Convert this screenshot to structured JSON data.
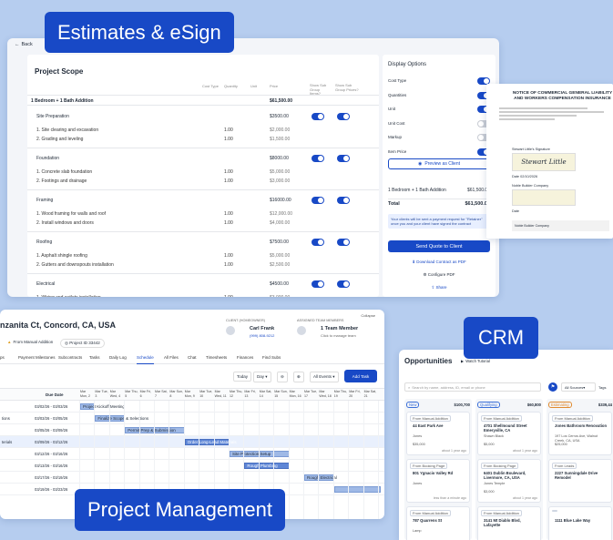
{
  "labels": {
    "estimates": "Estimates & eSign",
    "crm": "CRM",
    "pm": "Project Management"
  },
  "estimate": {
    "back": "Back",
    "title": "Project Scope",
    "headers": [
      "Cost Type",
      "Quantity",
      "Unit",
      "Price",
      "Show Sub Group Items?",
      "Show Sub Group Prices?"
    ],
    "top_group": {
      "name": "1 Bedroom + 1 Bath Addition",
      "price": "$61,500.00"
    },
    "groups": [
      {
        "name": "Site Preparation",
        "price": "$3500.00",
        "items": [
          {
            "name": "1. Site clearing and excavation",
            "qty": "1.00",
            "price": "$2,000.00"
          },
          {
            "name": "2. Grading and leveling",
            "qty": "1.00",
            "price": "$1,500.00"
          }
        ]
      },
      {
        "name": "Foundation",
        "price": "$8000.00",
        "items": [
          {
            "name": "1. Concrete slab foundation",
            "qty": "1.00",
            "price": "$5,000.00"
          },
          {
            "name": "2. Footings and drainage",
            "qty": "1.00",
            "price": "$3,000.00"
          }
        ]
      },
      {
        "name": "Framing",
        "price": "$16000.00",
        "items": [
          {
            "name": "1. Wood framing for walls and roof",
            "qty": "1.00",
            "price": "$12,000.00"
          },
          {
            "name": "2. Install windows and doors",
            "qty": "1.00",
            "price": "$4,000.00"
          }
        ]
      },
      {
        "name": "Roofing",
        "price": "$7500.00",
        "items": [
          {
            "name": "1. Asphalt shingle roofing",
            "qty": "1.00",
            "price": "$5,000.00"
          },
          {
            "name": "2. Gutters and downspouts installation",
            "qty": "1.00",
            "price": "$2,500.00"
          }
        ]
      },
      {
        "name": "Electrical",
        "price": "$4500.00",
        "items": [
          {
            "name": "1. Wiring and outlets installation",
            "qty": "1.00",
            "price": "$3,000.00"
          }
        ]
      }
    ]
  },
  "display": {
    "title": "Display Options",
    "options": [
      {
        "label": "Cost Type",
        "on": true
      },
      {
        "label": "Quantities",
        "on": true
      },
      {
        "label": "Unit",
        "on": true
      },
      {
        "label": "Unit Cost",
        "on": false
      },
      {
        "label": "Markup",
        "on": false
      },
      {
        "label": "Item Price",
        "on": true
      }
    ],
    "preview": "Preview as Client",
    "summary_item": "1 Bedroom + 1 Bath Addition",
    "summary_price": "$61,500.00",
    "total_label": "Total",
    "total": "$61,500.00",
    "note": "Your clients will be sent a payment request for \"Retainer\" once you and your client have signed the contract",
    "send": "Send Quote to Client",
    "download": "Download Contract as PDF",
    "configure": "Configure PDF",
    "share": "Share"
  },
  "doc": {
    "title": "NOTICE OF COMMERCIAL GENERAL LIABILITY AND WORKERS COMPENSATION INSURANCE",
    "sig_label": "Stewart Little's Signature",
    "sig": "Stewart Little",
    "date_label": "Date",
    "date": "02/10/2026",
    "builder_label": "Noble Builder Company",
    "date2_label": "Date",
    "footer": "Noble Builder Company"
  },
  "pm": {
    "address": "nzanita Ct, Concord, CA, USA",
    "collapse": "Collapse",
    "source": "From Manual Addition",
    "project_id": "Project ID 33442",
    "client_label": "CLIENT (HOMEOWNER)",
    "client_name": "Carl Frank",
    "client_phone": "(999) 808-9212",
    "team_label": "ASSIGNED TEAM MEMBERS",
    "team_value": "1 Team Member",
    "team_sub": "Click to manage team",
    "tabs": [
      "ps",
      "Payment Milestones",
      "Subcontracts",
      "Tasks",
      "Daily Log",
      "Schedule",
      "All Files",
      "Chat",
      "Timesheets",
      "Finances",
      "Find Subs"
    ],
    "active_tab": "Schedule",
    "today": "Today",
    "day": "Day",
    "all_events": "All Events",
    "add_task": "Add Task",
    "due_header": "Due Date",
    "dates": [
      "Mar Mon, 2",
      "Mar Tue, 3",
      "Mar Wed, 4",
      "Mar Thu, 5",
      "Mar Fri, 6",
      "Mar Sat, 7",
      "Mar Sun, 8",
      "Mar Mon, 9",
      "Mar Tue, 10",
      "Mar Wed, 11",
      "Mar Thu, 12",
      "Mar Fri, 13",
      "Mar Sat, 14",
      "Mar Sun, 15",
      "Mar Mon, 16",
      "Mar Tue, 17",
      "Mar Wed, 18",
      "Mar Thu, 19",
      "Mar Fri, 20",
      "Mar Sat, 21"
    ],
    "rows": [
      {
        "left": "",
        "due": "03/02/26 - 03/03/26"
      },
      {
        "left": "tions",
        "due": "03/03/26 - 03/05/26"
      },
      {
        "left": "",
        "due": "03/05/26 - 03/09/26"
      },
      {
        "left": "terials",
        "due": "03/09/26 - 03/12/26"
      },
      {
        "left": "",
        "due": "03/12/26 - 03/16/26"
      },
      {
        "left": "",
        "due": "03/13/26 - 03/16/26"
      },
      {
        "left": "",
        "due": "03/17/26 - 03/19/26"
      },
      {
        "left": "",
        "due": "03/19/26 - 03/23/26"
      }
    ],
    "bars": [
      "Project Kickoff Meeting",
      "Finalize Scope & Selections",
      "Permit Prep & Submission",
      "Order Long-Lead Materials",
      "Site Protection Setup",
      "Rough Plumbing",
      "Rough Electrical",
      ""
    ]
  },
  "crm": {
    "title": "Opportunities",
    "watch": "Watch Tutorial",
    "add_lead": "Add Lead",
    "search_placeholder": "Search by name, address, ID, email or phone",
    "all_sources": "All Sources",
    "tags": "Tags",
    "columns": [
      {
        "name": "New",
        "amount": "$100,700",
        "color": "#3b6fd8",
        "cards": [
          {
            "source": "From Manual Addition",
            "addr": "44 East Park Ave",
            "city": "Jones",
            "amt": "$35,000",
            "ago": "about 1 year ago"
          },
          {
            "source": "From Booking Page",
            "addr": "801 Ygnacio Valley Rd",
            "city": "Jones",
            "amt": "",
            "ago": "less than a minute ago"
          },
          {
            "source": "From Manual Addition",
            "addr": "787 Quarrens St",
            "city": "Lamp",
            "amt": "",
            "ago": ""
          }
        ]
      },
      {
        "name": "Qualifying",
        "amount": "$60,800",
        "color": "#3b6fd8",
        "cards": [
          {
            "source": "From Manual Addition",
            "addr": "4701 Shellmound Street Emeryville, CA",
            "city": "Shawn Black",
            "amt": "$5,000",
            "ago": "about 1 year ago"
          },
          {
            "source": "From Booking Page",
            "addr": "6401 Dublin Boulevard, Livermore, CA, USA",
            "city": "Jones Temple",
            "amt": "$3,000",
            "ago": "about 1 year ago"
          },
          {
            "source": "From Manual Addition",
            "addr": "3141 Mt Diablo Blvd, Lafayette",
            "city": "",
            "amt": "",
            "ago": ""
          }
        ]
      },
      {
        "name": "Estimating",
        "amount": "$339,44",
        "color": "#e08a2e",
        "cards": [
          {
            "source": "From Manual Addition",
            "addr": "Jones Bathroom Renovation",
            "city": "197 Los Cerros Ave, Walnut Creek, CA, USA",
            "amt": "$25,000",
            "ago": ""
          },
          {
            "source": "From Leads",
            "addr": "2227 Sunningdale Drive Remodel",
            "city": "",
            "amt": "",
            "ago": ""
          },
          {
            "source": "",
            "addr": "1111 Blue Lake Way",
            "city": "",
            "amt": "",
            "ago": ""
          }
        ]
      }
    ]
  },
  "colors": {
    "accent": "#1849c6",
    "bg": "#b6cdef"
  }
}
